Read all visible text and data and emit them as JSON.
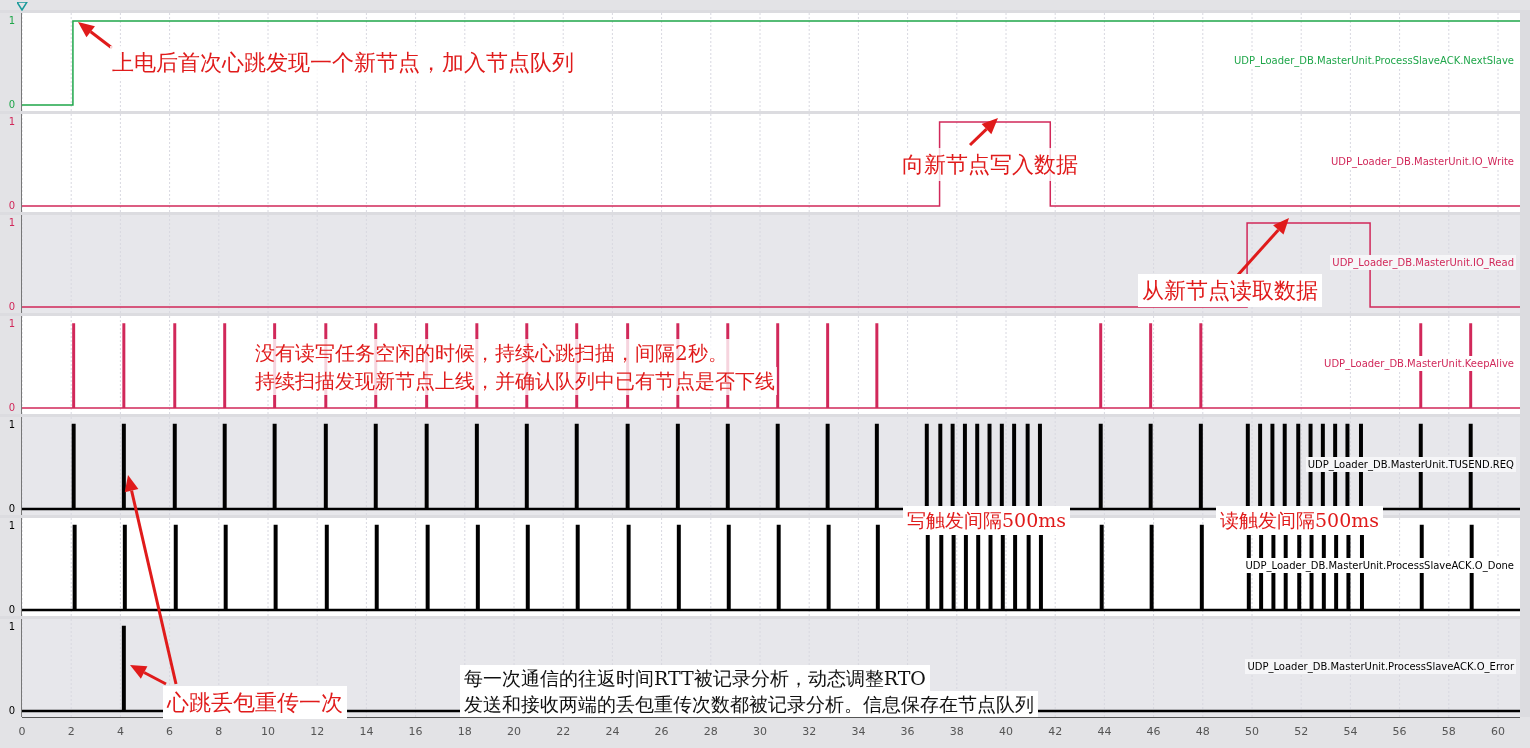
{
  "lanes": [
    {
      "shaded": false,
      "name": "UDP_Loader_DB.MasterUnit.ProcessSlaveACK.NextSlave",
      "color": "#1fa64a",
      "y_ticks": [
        "1",
        "0"
      ]
    },
    {
      "shaded": false,
      "name": "UDP_Loader_DB.MasterUnit.IO_Write",
      "color": "#d1285a",
      "y_ticks": [
        "1",
        "0"
      ]
    },
    {
      "shaded": true,
      "name": "UDP_Loader_DB.MasterUnit.IO_Read",
      "color": "#d1285a",
      "y_ticks": [
        "1",
        "0"
      ]
    },
    {
      "shaded": false,
      "name": "UDP_Loader_DB.MasterUnit.KeepAlive",
      "color": "#d1285a",
      "y_ticks": [
        "1",
        "0"
      ]
    },
    {
      "shaded": true,
      "name": "UDP_Loader_DB.MasterUnit.TUSEND.REQ",
      "color": "#000000",
      "y_ticks": [
        "1",
        "0"
      ]
    },
    {
      "shaded": false,
      "name": "UDP_Loader_DB.MasterUnit.ProcessSlaveACK.O_Done",
      "color": "#000000",
      "y_ticks": [
        "1",
        "0"
      ]
    },
    {
      "shaded": true,
      "name": "UDP_Loader_DB.MasterUnit.ProcessSlaveACK.O_Error",
      "color": "#000000",
      "y_ticks": [
        "1",
        "0"
      ]
    }
  ],
  "time_ticks": [
    "0",
    "2",
    "4",
    "6",
    "8",
    "10",
    "12",
    "14",
    "16",
    "18",
    "20",
    "22",
    "24",
    "26",
    "28",
    "30",
    "32",
    "34",
    "36",
    "38",
    "40",
    "42",
    "44",
    "46",
    "48",
    "50",
    "52",
    "54",
    "56",
    "58",
    "60"
  ],
  "annotations": [
    {
      "color": "#e01b1b",
      "lines": [
        "上电后首次心跳发现一个新节点，加入节点队列"
      ]
    },
    {
      "color": "#e01b1b",
      "lines": [
        "向新节点写入数据"
      ]
    },
    {
      "color": "#e01b1b",
      "lines": [
        "从新节点读取数据"
      ]
    },
    {
      "color": "#e01b1b",
      "lines": [
        "没有读写任务空闲的时候，持续心跳扫描，间隔2秒。",
        "持续扫描发现新节点上线，并确认队列中已有节点是否下线"
      ]
    },
    {
      "color": "#e01b1b",
      "lines": [
        "写触发间隔500ms"
      ]
    },
    {
      "color": "#e01b1b",
      "lines": [
        "读触发间隔500ms"
      ]
    },
    {
      "color": "#e01b1b",
      "lines": [
        "心跳丢包重传一次"
      ]
    },
    {
      "color": "#111111",
      "lines": [
        "每一次通信的往返时间RTT被记录分析，动态调整RTO",
        "发送和接收两端的丢包重传次数都被记录分析。信息保存在节点队列"
      ]
    }
  ]
}
